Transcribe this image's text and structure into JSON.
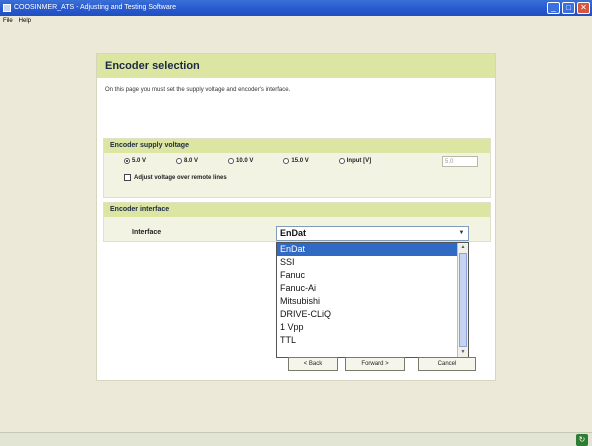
{
  "window": {
    "title": "COOSINMER_ATS - Adjusting and Testing Software",
    "minimize": "_",
    "maximize": "□",
    "close": "✕"
  },
  "menu": [
    "File",
    "Help"
  ],
  "panel": {
    "title": "Encoder selection",
    "description": "On this page you must set the supply voltage and encoder's interface."
  },
  "supply": {
    "title": "Encoder supply voltage",
    "options": [
      {
        "label": "5.0 V",
        "selected": true
      },
      {
        "label": "8.0 V",
        "selected": false
      },
      {
        "label": "10.0 V",
        "selected": false
      },
      {
        "label": "15.0 V",
        "selected": false
      },
      {
        "label": "Input [V]",
        "selected": false
      }
    ],
    "input_value": "5.0",
    "adjust_label": "Adjust voltage over remote lines",
    "adjust_checked": false
  },
  "interface": {
    "title": "Encoder interface",
    "label": "Interface",
    "selected": "EnDat",
    "options": [
      "EnDat",
      "SSI",
      "Fanuc",
      "Fanuc-Ai",
      "Mitsubishi",
      "DRIVE-CLiQ",
      "1 Vpp",
      "TTL"
    ]
  },
  "buttons": {
    "back": "< Back",
    "forward": "Forward >",
    "cancel": "Cancel"
  },
  "icons": {
    "scroll_up": "arrow-up-icon",
    "scroll_down": "arrow-down-icon",
    "tray": "network-icon"
  }
}
